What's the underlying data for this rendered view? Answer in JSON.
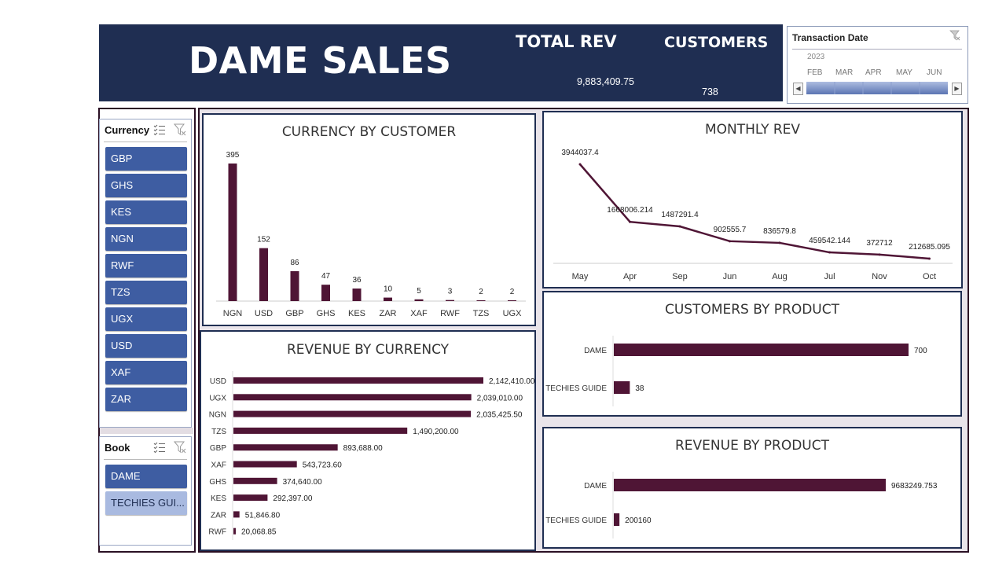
{
  "header": {
    "title": "DAME SALES",
    "total_rev_label": "TOTAL REV",
    "total_rev_value": "9,883,409.75",
    "customers_label": "CUSTOMERS",
    "customers_value": "738"
  },
  "timeline": {
    "title": "Transaction Date",
    "year": "2023",
    "months": [
      "FEB",
      "MAR",
      "APR",
      "MAY",
      "JUN"
    ],
    "left_arrow": "◀",
    "right_arrow": "▶",
    "filter_icon": "funnel-clear-icon"
  },
  "slicers": {
    "currency": {
      "title": "Currency",
      "items": [
        "GBP",
        "GHS",
        "KES",
        "NGN",
        "RWF",
        "TZS",
        "UGX",
        "USD",
        "XAF",
        "ZAR"
      ]
    },
    "book": {
      "title": "Book",
      "items": [
        "DAME",
        "TECHIES GUI..."
      ],
      "selected": [
        true,
        false
      ]
    }
  },
  "colors": {
    "bar": "#4f1535",
    "header": "#1f2e52",
    "slicer": "#3e5da2"
  },
  "chart_data": [
    {
      "id": "currency_by_customer",
      "type": "bar",
      "title": "CURRENCY BY CUSTOMER",
      "categories": [
        "NGN",
        "USD",
        "GBP",
        "GHS",
        "KES",
        "ZAR",
        "XAF",
        "RWF",
        "TZS",
        "UGX"
      ],
      "values": [
        395,
        152,
        86,
        47,
        36,
        10,
        5,
        3,
        2,
        2
      ],
      "labels": [
        "395",
        "152",
        "86",
        "47",
        "36",
        "10",
        "5",
        "3",
        "2",
        "2"
      ]
    },
    {
      "id": "monthly_rev",
      "type": "line",
      "title": "MONTHLY REV",
      "categories": [
        "May",
        "Apr",
        "Sep",
        "Jun",
        "Aug",
        "Jul",
        "Nov",
        "Oct"
      ],
      "values": [
        3944037.4,
        1668006.214,
        1487291.4,
        902555.7,
        836579.8,
        459542.144,
        372712,
        212685.095
      ],
      "labels": [
        "3944037.4",
        "1668006.214",
        "1487291.4",
        "902555.7",
        "836579.8",
        "459542.144",
        "372712",
        "212685.095"
      ]
    },
    {
      "id": "revenue_by_currency",
      "type": "bar",
      "orientation": "horizontal",
      "title": "REVENUE BY CURRENCY",
      "categories": [
        "USD",
        "UGX",
        "NGN",
        "TZS",
        "GBP",
        "XAF",
        "GHS",
        "KES",
        "ZAR",
        "RWF"
      ],
      "values": [
        2142410.0,
        2039010.0,
        2035425.5,
        1490200.0,
        893688.0,
        543723.6,
        374640.0,
        292397.0,
        51846.8,
        20068.85
      ],
      "labels": [
        "2,142,410.00",
        "2,039,010.00",
        "2,035,425.50",
        "1,490,200.00",
        "893,688.00",
        "543,723.60",
        "374,640.00",
        "292,397.00",
        "51,846.80",
        "20,068.85"
      ]
    },
    {
      "id": "customers_by_product",
      "type": "bar",
      "orientation": "horizontal",
      "title": "CUSTOMERS BY PRODUCT",
      "categories": [
        "DAME",
        "TECHIES GUIDE"
      ],
      "values": [
        700,
        38
      ],
      "labels": [
        "700",
        "38"
      ]
    },
    {
      "id": "revenue_by_product",
      "type": "bar",
      "orientation": "horizontal",
      "title": "REVENUE BY PRODUCT",
      "categories": [
        "DAME",
        "TECHIES GUIDE"
      ],
      "values": [
        9683249.753,
        200160
      ],
      "labels": [
        "9683249.753",
        "200160"
      ]
    }
  ]
}
